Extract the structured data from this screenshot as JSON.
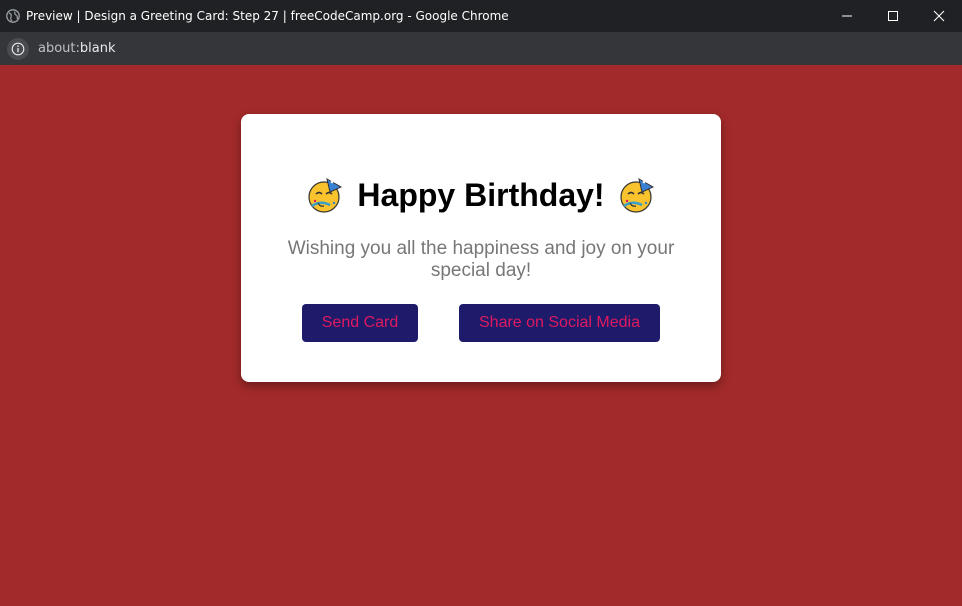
{
  "window": {
    "title": "Preview | Design a Greeting Card: Step 27 | freeCodeCamp.org - Google Chrome",
    "controls": [
      "minimize-icon",
      "maximize-icon",
      "close-icon"
    ]
  },
  "addressbar": {
    "url_prefix": "about:",
    "url_host": "blank",
    "info_icon": "info-icon"
  },
  "page": {
    "background_color": "#a32a2a"
  },
  "card": {
    "heading": "Happy Birthday!",
    "heading_emoji": "partying-face-emoji",
    "message": "Wishing you all the happiness and joy on your special day!",
    "buttons": [
      {
        "label": "Send Card"
      },
      {
        "label": "Share on Social Media"
      }
    ],
    "button_background": "#1e1b6b",
    "button_text_color": "#e0195f"
  }
}
